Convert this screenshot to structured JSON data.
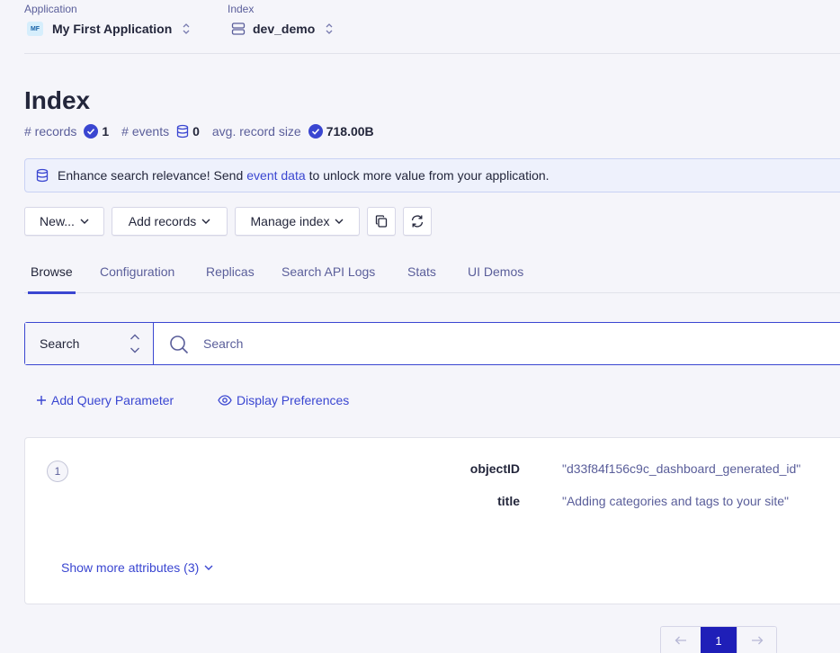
{
  "header": {
    "application": {
      "label": "Application",
      "initials": "MF",
      "value": "My First Application",
      "icon": "updown-chevron-icon"
    },
    "index": {
      "label": "Index",
      "value": "dev_demo",
      "icon": "server-icon"
    }
  },
  "page": {
    "title": "Index",
    "stats": {
      "records_label": "# records",
      "records_value": "1",
      "events_label": "# events",
      "events_value": "0",
      "size_label": "avg. record size",
      "size_value": "718.00B"
    }
  },
  "banner": {
    "text_before": "Enhance search relevance! Send",
    "link": "event data",
    "text_after": "to unlock more value from your application."
  },
  "toolbar": {
    "new_label": "New...",
    "add_records_label": "Add records",
    "manage_index_label": "Manage index",
    "copy_icon": "copy-icon",
    "refresh_icon": "refresh-icon"
  },
  "tabs": [
    "Browse",
    "Configuration",
    "Replicas",
    "Search API Logs",
    "Stats",
    "UI Demos"
  ],
  "active_tab": "Browse",
  "search": {
    "mode": "Search",
    "placeholder": "Search"
  },
  "query": {
    "add_param": "Add Query Parameter",
    "display_prefs": "Display Preferences"
  },
  "results": [
    {
      "index": "1",
      "attributes": [
        {
          "key": "objectID",
          "value": "\"d33f84f156c9c_dashboard_generated_id\""
        },
        {
          "key": "title",
          "value": "\"Adding categories and tags to your site\""
        }
      ],
      "show_more": "Show more attributes (3)"
    }
  ],
  "pagination": {
    "current": "1"
  },
  "colors": {
    "accent": "#3a46d1",
    "text": "#23263b",
    "muted": "#5a5e9a",
    "page_active": "#1f1fb8"
  }
}
